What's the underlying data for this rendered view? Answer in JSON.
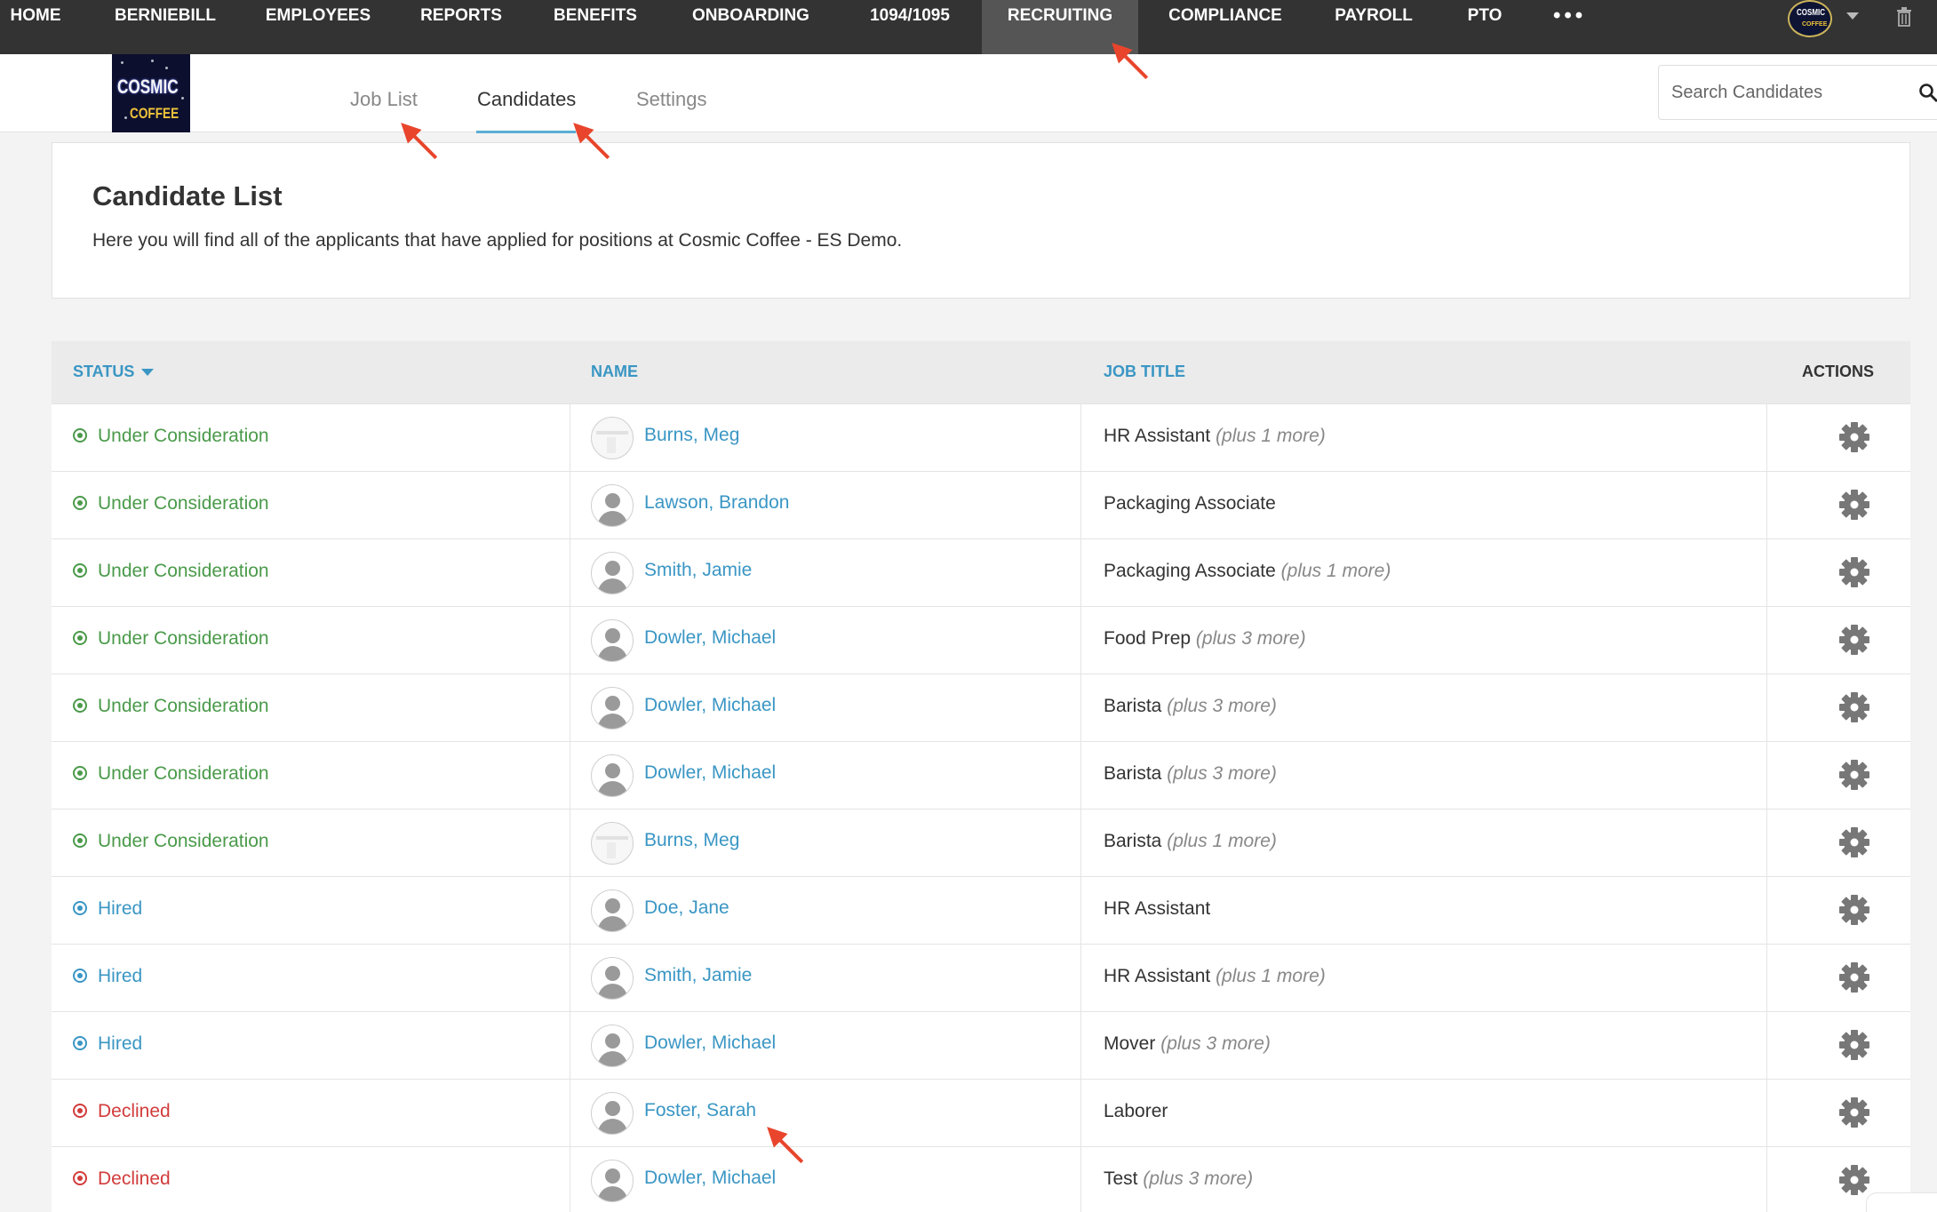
{
  "topnav": {
    "items": [
      {
        "label": "HOME"
      },
      {
        "label": "BERNIEBILL"
      },
      {
        "label": "EMPLOYEES"
      },
      {
        "label": "REPORTS"
      },
      {
        "label": "BENEFITS"
      },
      {
        "label": "ONBOARDING"
      },
      {
        "label": "1094/1095"
      },
      {
        "label": "RECRUITING",
        "active": true
      },
      {
        "label": "COMPLIANCE"
      },
      {
        "label": "PAYROLL"
      },
      {
        "label": "PTO"
      }
    ],
    "more_label": "•••",
    "avatar_text_1": "COSMIC",
    "avatar_text_2": "COFFEE"
  },
  "logo": {
    "line1": "COSMIC",
    "line2": "COFFEE"
  },
  "subnav": {
    "tabs": [
      {
        "label": "Job List"
      },
      {
        "label": "Candidates",
        "active": true
      },
      {
        "label": "Settings"
      }
    ],
    "search_placeholder": "Search Candidates"
  },
  "intro": {
    "title": "Candidate List",
    "description": "Here you will find all of the applicants that have applied for positions at Cosmic Coffee - ES Demo."
  },
  "table": {
    "headers": {
      "status": "STATUS",
      "name": "NAME",
      "job_title": "JOB TITLE",
      "actions": "ACTIONS"
    },
    "rows": [
      {
        "status": "Under Consideration",
        "kind": "consider",
        "name": "Burns, Meg",
        "photo": true,
        "job": "HR Assistant",
        "more": "(plus 1 more)"
      },
      {
        "status": "Under Consideration",
        "kind": "consider",
        "name": "Lawson, Brandon",
        "photo": false,
        "job": "Packaging Associate",
        "more": ""
      },
      {
        "status": "Under Consideration",
        "kind": "consider",
        "name": "Smith, Jamie",
        "photo": false,
        "job": "Packaging Associate",
        "more": "(plus 1 more)"
      },
      {
        "status": "Under Consideration",
        "kind": "consider",
        "name": "Dowler, Michael",
        "photo": false,
        "job": "Food Prep",
        "more": "(plus 3 more)"
      },
      {
        "status": "Under Consideration",
        "kind": "consider",
        "name": "Dowler, Michael",
        "photo": false,
        "job": "Barista",
        "more": "(plus 3 more)"
      },
      {
        "status": "Under Consideration",
        "kind": "consider",
        "name": "Dowler, Michael",
        "photo": false,
        "job": "Barista",
        "more": "(plus 3 more)"
      },
      {
        "status": "Under Consideration",
        "kind": "consider",
        "name": "Burns, Meg",
        "photo": true,
        "job": "Barista",
        "more": "(plus 1 more)"
      },
      {
        "status": "Hired",
        "kind": "hired",
        "name": "Doe, Jane",
        "photo": false,
        "job": "HR Assistant",
        "more": ""
      },
      {
        "status": "Hired",
        "kind": "hired",
        "name": "Smith, Jamie",
        "photo": false,
        "job": "HR Assistant",
        "more": "(plus 1 more)"
      },
      {
        "status": "Hired",
        "kind": "hired",
        "name": "Dowler, Michael",
        "photo": false,
        "job": "Mover",
        "more": "(plus 3 more)"
      },
      {
        "status": "Declined",
        "kind": "declined",
        "name": "Foster, Sarah",
        "photo": false,
        "job": "Laborer",
        "more": ""
      },
      {
        "status": "Declined",
        "kind": "declined",
        "name": "Dowler, Michael",
        "photo": false,
        "job": "Test",
        "more": "(plus 3 more)"
      }
    ]
  },
  "colors": {
    "nav_bg": "#333333",
    "accent_blue": "#3a96c4",
    "status_consider": "#4a9a4a",
    "status_hired": "#3a96c4",
    "status_declined": "#d23c3c",
    "annotation_arrow": "#e8452c"
  }
}
